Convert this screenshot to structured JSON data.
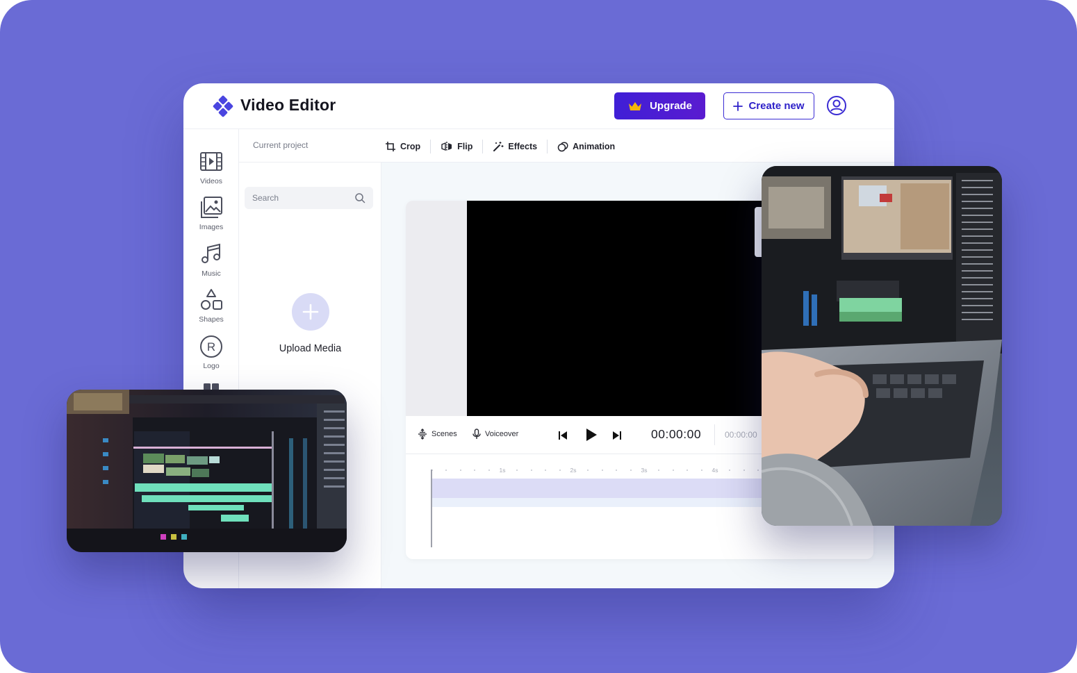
{
  "app": {
    "title": "Video Editor"
  },
  "header": {
    "upgrade_label": "Upgrade",
    "create_new_label": "Create new"
  },
  "sidebar": {
    "items": [
      {
        "label": "Videos",
        "icon": "film-icon"
      },
      {
        "label": "Images",
        "icon": "image-gallery-icon"
      },
      {
        "label": "Music",
        "icon": "music-note-icon"
      },
      {
        "label": "Shapes",
        "icon": "shapes-icon"
      },
      {
        "label": "Logo",
        "icon": "registered-icon"
      }
    ]
  },
  "project": {
    "label": "Current project"
  },
  "toolbar": {
    "tools": [
      {
        "label": "Crop",
        "icon": "crop-icon"
      },
      {
        "label": "Flip",
        "icon": "flip-icon"
      },
      {
        "label": "Effects",
        "icon": "magic-wand-icon"
      },
      {
        "label": "Animation",
        "icon": "animation-icon"
      }
    ]
  },
  "media": {
    "search_placeholder": "Search",
    "upload_label": "Upload Media"
  },
  "player": {
    "scenes_label": "Scenes",
    "voiceover_label": "Voiceover",
    "current_time": "00:00:00",
    "total_time": "00:00:00"
  },
  "timeline": {
    "tick_labels": [
      "1s",
      "2s",
      "3s",
      "4s"
    ]
  },
  "colors": {
    "background": "#6a6bd5",
    "brand": "#4a45e0",
    "upgrade_gradient_start": "#3f1fd6",
    "upgrade_gradient_end": "#5a1bd0",
    "crown": "#f5b70a",
    "track": "#dcdcf6"
  }
}
